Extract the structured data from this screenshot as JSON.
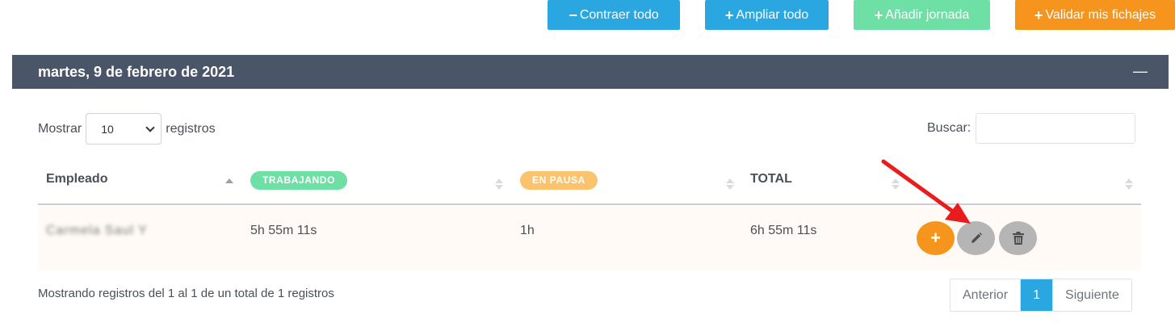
{
  "toolbar": {
    "collapse_all": "Contraer todo",
    "expand_all": "Ampliar todo",
    "add_day": "Añadir jornada",
    "validate": "Validar mis fichajes"
  },
  "day_card": {
    "date": "martes, 9 de febrero de 2021",
    "minimize_symbol": "—"
  },
  "table_controls": {
    "show_label": "Mostrar",
    "page_size": "10",
    "records_label": "registros",
    "search_label": "Buscar:",
    "search_value": ""
  },
  "table": {
    "headers": {
      "employee": "Empleado",
      "working": "TRABAJANDO",
      "paused": "EN PAUSA",
      "total": "TOTAL"
    },
    "rows": [
      {
        "employee": "Carmela Saul Y",
        "working": "5h 55m 11s",
        "paused": "1h",
        "total": "6h 55m 11s"
      }
    ]
  },
  "footer": {
    "info": "Mostrando registros del 1 al 1 de un total de 1 registros",
    "prev": "Anterior",
    "current_page": "1",
    "next": "Siguiente"
  },
  "colors": {
    "primary": "#2aa7e1",
    "success": "#6ee0a6",
    "warning": "#f5951d",
    "header_bg": "#4a5668",
    "arrow": "#e81c1c"
  },
  "icons": {
    "collapse": "minus-icon",
    "expand": "plus-icon",
    "add": "plus-icon",
    "validate": "plus-icon",
    "edit": "pencil-icon",
    "delete": "trash-icon"
  }
}
